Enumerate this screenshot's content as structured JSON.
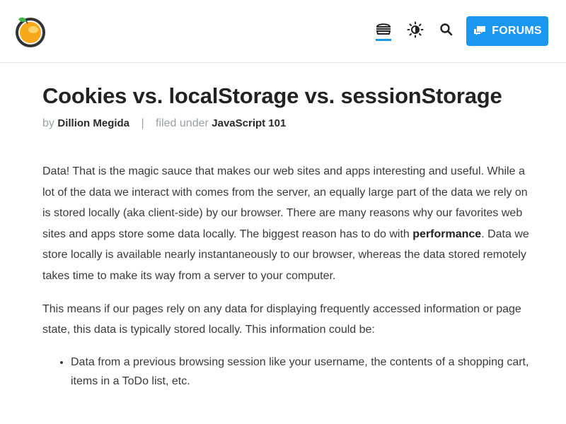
{
  "header": {
    "logo": "orange-logo",
    "icons": [
      "menu-icon",
      "theme-toggle-icon",
      "search-icon",
      "chat-icon"
    ],
    "forums_label": "FORUMS",
    "colors": {
      "accent": "#1a97f0",
      "logo_orange": "#f7a81b",
      "logo_leaf": "#3db84b",
      "logo_ring": "#333333"
    }
  },
  "article": {
    "title": "Cookies vs. localStorage vs. sessionStorage",
    "by_label": "by",
    "author": "Dillion Megida",
    "separator": "|",
    "filed_label": "filed under",
    "category": "JavaScript 101",
    "p1_start": "Data! That is the magic sauce that makes our web sites and apps interesting and useful. While a lot of the data we interact with comes from the server, an equally large part of the data we rely on is stored locally (aka client-side) by our browser. There are many reasons why our favorites web sites and apps store some data locally. The biggest reason has to do with ",
    "p1_bold": "performance",
    "p1_end": ". Data we store locally is available nearly instantaneously to our browser, whereas the data stored remotely takes time to make its way from a server to your computer.",
    "p2": "This means if our pages rely on any data for displaying frequently accessed information or page state, this data is typically stored locally. This information could be:",
    "list_items": [
      "Data from a previous browsing session like your username,  the contents of a shopping cart, items in a ToDo list, etc."
    ]
  }
}
